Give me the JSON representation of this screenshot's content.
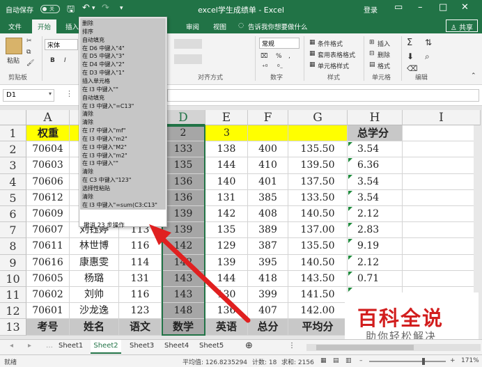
{
  "titlebar": {
    "autosave_label": "自动保存",
    "autosave_state": "关",
    "title": "excel学生成绩单 - Excel",
    "login": "登录",
    "save_icon": "save-icon",
    "undo_icon": "undo-icon",
    "redo_icon": "redo-icon"
  },
  "ribbon_tabs": [
    "文件",
    "开始",
    "插入",
    "页面布局",
    "公式",
    "数据",
    "审阅",
    "视图",
    "告诉我你想要做什么",
    "共享"
  ],
  "ribbon": {
    "paste": "粘贴",
    "clipboard": "剪贴板",
    "font_name": "宋体",
    "font_size": "11",
    "bold": "B",
    "italic": "I",
    "alignment": "对齐方式",
    "number_format": "常规",
    "percent": "%",
    "comma": ",",
    "number": "数字",
    "cond_format": "条件格式",
    "table_format": "套用表格格式",
    "cell_style": "单元格样式",
    "styles": "样式",
    "insert": "插入",
    "delete": "删除",
    "format": "格式",
    "cells": "单元格",
    "editing": "编辑"
  },
  "formula_bar": {
    "name_box": "D1",
    "fx": "fx"
  },
  "undo_menu": {
    "items": [
      "删除",
      "排序",
      "自动填充",
      "在 D6 中键入\"4\"",
      "在 D5 中键入\"3\"",
      "在 D4 中键入\"2\"",
      "在 D3 中键入\"1\"",
      "插入单元格",
      "在 I3 中键入\"\"",
      "自动填充",
      "在 I3 中键入\"=C13\"",
      "清除",
      "清除",
      "在 I7 中键入\"mf\"",
      "在 I3 中键入\"m2\"",
      "在 I3 中键入\"M2\"",
      "在 I3 中键入\"m2\"",
      "在 I3 中键入\"\"",
      "清除",
      "在 C3 中键入\"123\"",
      "选择性粘贴",
      "清除",
      "在 I3 中键入\"=sum(C3:C13\""
    ],
    "status": "撤消 23 步操作"
  },
  "columns": [
    "A",
    "B",
    "C",
    "D",
    "E",
    "F",
    "G",
    "H",
    "I"
  ],
  "rows": [
    [
      "权重",
      "",
      "",
      "2",
      "3",
      "",
      "",
      "总学分",
      ""
    ],
    [
      "70604",
      "",
      "",
      "133",
      "138",
      "400",
      "135.50",
      "3.54",
      ""
    ],
    [
      "70603",
      "",
      "",
      "135",
      "144",
      "410",
      "139.50",
      "6.36",
      ""
    ],
    [
      "70606",
      "",
      "",
      "136",
      "140",
      "401",
      "137.50",
      "3.54",
      ""
    ],
    [
      "70612",
      "",
      "",
      "136",
      "131",
      "385",
      "133.50",
      "3.54",
      ""
    ],
    [
      "70609",
      "",
      "",
      "139",
      "142",
      "408",
      "140.50",
      "2.12",
      ""
    ],
    [
      "70607",
      "刘钰婷",
      "113",
      "139",
      "135",
      "389",
      "137.00",
      "2.83",
      ""
    ],
    [
      "70611",
      "林世博",
      "116",
      "142",
      "129",
      "387",
      "135.50",
      "9.19",
      ""
    ],
    [
      "70616",
      "康惠雯",
      "114",
      "142",
      "139",
      "395",
      "140.50",
      "2.12",
      ""
    ],
    [
      "70605",
      "杨璐",
      "131",
      "143",
      "144",
      "418",
      "143.50",
      "0.71",
      ""
    ],
    [
      "70602",
      "刘帅",
      "116",
      "143",
      "130",
      "399",
      "141.50",
      "",
      ""
    ],
    [
      "70601",
      "沙龙逸",
      "123",
      "148",
      "136",
      "407",
      "142.00",
      "",
      ""
    ],
    [
      "考号",
      "姓名",
      "语文",
      "数学",
      "英语",
      "总分",
      "平均分",
      "",
      ""
    ]
  ],
  "row_numbers": [
    "1",
    "2",
    "3",
    "4",
    "5",
    "6",
    "7",
    "8",
    "9",
    "10",
    "11",
    "12",
    "13"
  ],
  "sheet_tabs": [
    "Sheet1",
    "Sheet2",
    "Sheet3",
    "Sheet4",
    "Sheet5"
  ],
  "statusbar": {
    "ready": "就绪",
    "average": "平均值: 126.8235294",
    "count": "计数: 18",
    "sum": "求和: 2156",
    "zoom": "171%"
  },
  "watermark": {
    "title": "百科全说",
    "subtitle": "助你轻松解决"
  },
  "colors": {
    "excel_green": "#217346",
    "highlight_yellow": "#ffff00",
    "arrow_red": "#e02020"
  }
}
